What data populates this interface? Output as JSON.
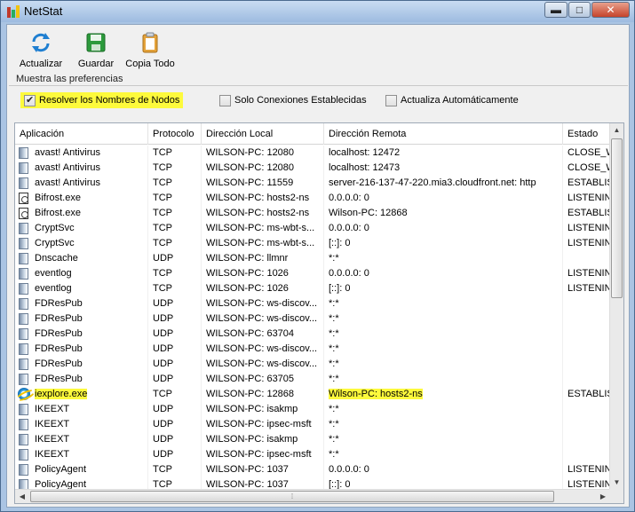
{
  "window": {
    "title": "NetStat",
    "controls": {
      "minimize": "▬",
      "maximize": "□",
      "close": "✕"
    }
  },
  "toolbar": {
    "refresh_label": "Actualizar",
    "save_label": "Guardar",
    "copy_all_label": "Copia Todo"
  },
  "preferences": {
    "legend": "Muestra las preferencias",
    "options": [
      {
        "label": "Resolver los Nombres de Nodos",
        "checked": true
      },
      {
        "label": "Solo Conexiones Establecidas",
        "checked": false
      },
      {
        "label": "Actualiza Automáticamente",
        "checked": false
      }
    ]
  },
  "table": {
    "columns": [
      "Aplicación",
      "Protocolo",
      "Dirección Local",
      "Dirección Remota",
      "Estado"
    ],
    "rows": [
      {
        "icon": "doc",
        "app": "avast! Antivirus",
        "proto": "TCP",
        "local": "WILSON-PC: 12080",
        "remote": "localhost: 12472",
        "state": "CLOSE_W"
      },
      {
        "icon": "doc",
        "app": "avast! Antivirus",
        "proto": "TCP",
        "local": "WILSON-PC: 12080",
        "remote": "localhost: 12473",
        "state": "CLOSE_W"
      },
      {
        "icon": "doc",
        "app": "avast! Antivirus",
        "proto": "TCP",
        "local": "WILSON-PC: 11559",
        "remote": "server-216-137-47-220.mia3.cloudfront.net: http",
        "state": "ESTABLIS"
      },
      {
        "icon": "pic",
        "app": "Bifrost.exe",
        "proto": "TCP",
        "local": "WILSON-PC: hosts2-ns",
        "remote": "0.0.0.0: 0",
        "state": "LISTENING"
      },
      {
        "icon": "pic",
        "app": "Bifrost.exe",
        "proto": "TCP",
        "local": "WILSON-PC: hosts2-ns",
        "remote": "Wilson-PC: 12868",
        "state": "ESTABLIS"
      },
      {
        "icon": "doc",
        "app": "CryptSvc",
        "proto": "TCP",
        "local": "WILSON-PC: ms-wbt-s...",
        "remote": "0.0.0.0: 0",
        "state": "LISTENING"
      },
      {
        "icon": "doc",
        "app": "CryptSvc",
        "proto": "TCP",
        "local": "WILSON-PC: ms-wbt-s...",
        "remote": "[::]: 0",
        "state": "LISTENING"
      },
      {
        "icon": "doc",
        "app": "Dnscache",
        "proto": "UDP",
        "local": "WILSON-PC: llmnr",
        "remote": "*:*",
        "state": ""
      },
      {
        "icon": "doc",
        "app": "eventlog",
        "proto": "TCP",
        "local": "WILSON-PC: 1026",
        "remote": "0.0.0.0: 0",
        "state": "LISTENING"
      },
      {
        "icon": "doc",
        "app": "eventlog",
        "proto": "TCP",
        "local": "WILSON-PC: 1026",
        "remote": "[::]: 0",
        "state": "LISTENING"
      },
      {
        "icon": "doc",
        "app": "FDResPub",
        "proto": "UDP",
        "local": "WILSON-PC: ws-discov...",
        "remote": "*:*",
        "state": ""
      },
      {
        "icon": "doc",
        "app": "FDResPub",
        "proto": "UDP",
        "local": "WILSON-PC: ws-discov...",
        "remote": "*:*",
        "state": ""
      },
      {
        "icon": "doc",
        "app": "FDResPub",
        "proto": "UDP",
        "local": "WILSON-PC: 63704",
        "remote": "*:*",
        "state": ""
      },
      {
        "icon": "doc",
        "app": "FDResPub",
        "proto": "UDP",
        "local": "WILSON-PC: ws-discov...",
        "remote": "*:*",
        "state": ""
      },
      {
        "icon": "doc",
        "app": "FDResPub",
        "proto": "UDP",
        "local": "WILSON-PC: ws-discov...",
        "remote": "*:*",
        "state": ""
      },
      {
        "icon": "doc",
        "app": "FDResPub",
        "proto": "UDP",
        "local": "WILSON-PC: 63705",
        "remote": "*:*",
        "state": ""
      },
      {
        "icon": "ie",
        "app": "iexplore.exe",
        "proto": "TCP",
        "local": "WILSON-PC: 12868",
        "remote": "Wilson-PC: hosts2-ns",
        "state": "ESTABLIS",
        "highlight": true
      },
      {
        "icon": "doc",
        "app": "IKEEXT",
        "proto": "UDP",
        "local": "WILSON-PC: isakmp",
        "remote": "*:*",
        "state": ""
      },
      {
        "icon": "doc",
        "app": "IKEEXT",
        "proto": "UDP",
        "local": "WILSON-PC: ipsec-msft",
        "remote": "*:*",
        "state": ""
      },
      {
        "icon": "doc",
        "app": "IKEEXT",
        "proto": "UDP",
        "local": "WILSON-PC: isakmp",
        "remote": "*:*",
        "state": ""
      },
      {
        "icon": "doc",
        "app": "IKEEXT",
        "proto": "UDP",
        "local": "WILSON-PC: ipsec-msft",
        "remote": "*:*",
        "state": ""
      },
      {
        "icon": "doc",
        "app": "PolicyAgent",
        "proto": "TCP",
        "local": "WILSON-PC: 1037",
        "remote": "0.0.0.0: 0",
        "state": "LISTENING"
      },
      {
        "icon": "doc",
        "app": "PolicyAgent",
        "proto": "TCP",
        "local": "WILSON-PC: 1037",
        "remote": "[::]: 0",
        "state": "LISTENING"
      }
    ]
  },
  "colors": {
    "highlight": "#fdfa3c",
    "titlebar": "#9dbbe0"
  }
}
